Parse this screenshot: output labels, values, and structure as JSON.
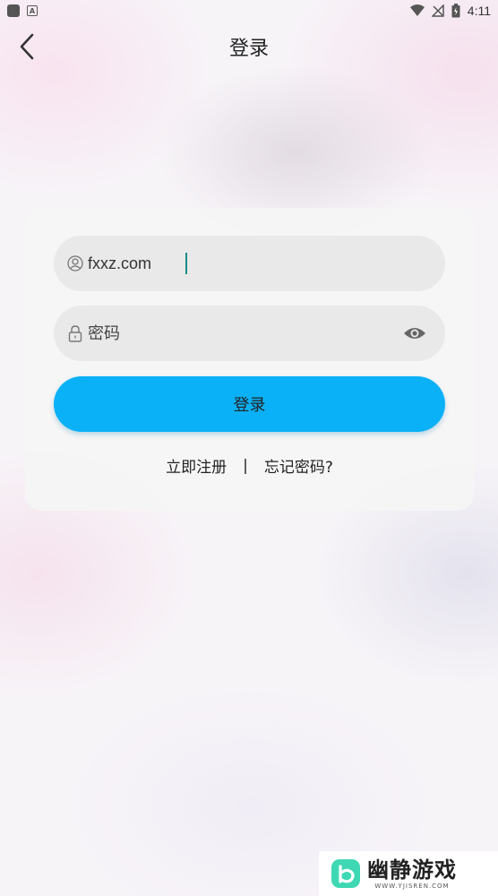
{
  "status_bar": {
    "time": "4:11",
    "icons": [
      "notification-square-icon",
      "a-app-icon",
      "wifi-icon",
      "no-signal-icon",
      "battery-charging-icon"
    ]
  },
  "header": {
    "title": "登录",
    "back_icon": "chevron-left-icon"
  },
  "login_form": {
    "username": {
      "value": "fxxz.com",
      "icon": "user-icon"
    },
    "password": {
      "placeholder": "密码",
      "value": "",
      "icon": "lock-icon",
      "toggle_icon": "eye-icon"
    },
    "submit_label": "登录",
    "register_label": "立即注册",
    "separator": "|",
    "forgot_label": "忘记密码?"
  },
  "watermark": {
    "name": "幽静游戏",
    "url": "WWW.YJISREN.COM"
  },
  "colors": {
    "primary_button": "#0bb1f7",
    "field_bg": "#e9e9e9",
    "caret": "#1a8a8a"
  }
}
